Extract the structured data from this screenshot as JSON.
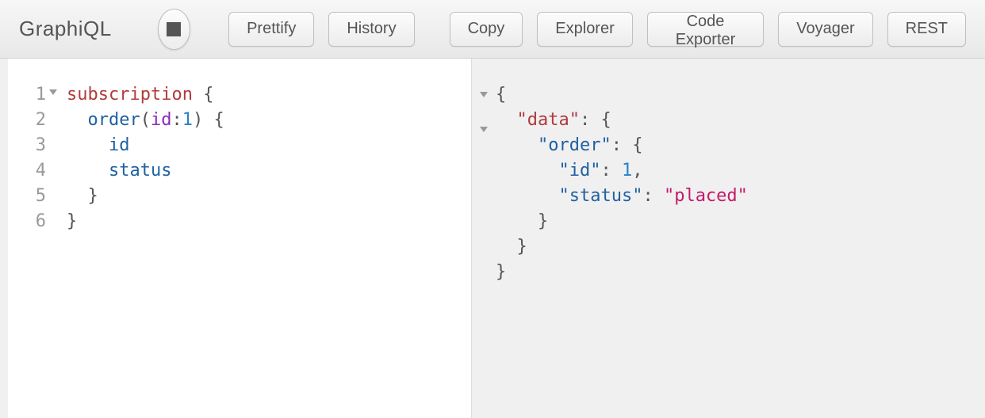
{
  "app": {
    "title": "GraphiQL"
  },
  "toolbar": {
    "prettify": "Prettify",
    "history": "History",
    "copy": "Copy",
    "explorer": "Explorer",
    "code_exporter": "Code Exporter",
    "voyager": "Voyager",
    "rest": "REST"
  },
  "query": {
    "gutter": [
      "1",
      "2",
      "3",
      "4",
      "5",
      "6"
    ],
    "lines": [
      {
        "t": [
          {
            "c": "kw",
            "v": "subscription"
          },
          {
            "c": "pun",
            "v": " {"
          }
        ]
      },
      {
        "t": [
          {
            "c": "pun",
            "v": "  "
          },
          {
            "c": "fld",
            "v": "order"
          },
          {
            "c": "pun",
            "v": "("
          },
          {
            "c": "arg",
            "v": "id"
          },
          {
            "c": "pun",
            "v": ":"
          },
          {
            "c": "num",
            "v": "1"
          },
          {
            "c": "pun",
            "v": ") {"
          }
        ]
      },
      {
        "t": [
          {
            "c": "pun",
            "v": "    "
          },
          {
            "c": "fld",
            "v": "id"
          }
        ]
      },
      {
        "t": [
          {
            "c": "pun",
            "v": "    "
          },
          {
            "c": "fld",
            "v": "status"
          }
        ]
      },
      {
        "t": [
          {
            "c": "pun",
            "v": "  }"
          }
        ]
      },
      {
        "t": [
          {
            "c": "pun",
            "v": "}"
          }
        ]
      }
    ]
  },
  "result": {
    "lines": [
      {
        "t": [
          {
            "c": "rpun",
            "v": "{"
          }
        ]
      },
      {
        "t": [
          {
            "c": "rpun",
            "v": "  "
          },
          {
            "c": "dkey",
            "v": "\"data\""
          },
          {
            "c": "rpun",
            "v": ": {"
          }
        ]
      },
      {
        "t": [
          {
            "c": "rpun",
            "v": "    "
          },
          {
            "c": "key",
            "v": "\"order\""
          },
          {
            "c": "rpun",
            "v": ": {"
          }
        ]
      },
      {
        "t": [
          {
            "c": "rpun",
            "v": "      "
          },
          {
            "c": "key",
            "v": "\"id\""
          },
          {
            "c": "rpun",
            "v": ": "
          },
          {
            "c": "rnum",
            "v": "1"
          },
          {
            "c": "rpun",
            "v": ","
          }
        ]
      },
      {
        "t": [
          {
            "c": "rpun",
            "v": "      "
          },
          {
            "c": "key",
            "v": "\"status\""
          },
          {
            "c": "rpun",
            "v": ": "
          },
          {
            "c": "rstr",
            "v": "\"placed\""
          }
        ]
      },
      {
        "t": [
          {
            "c": "rpun",
            "v": "    }"
          }
        ]
      },
      {
        "t": [
          {
            "c": "rpun",
            "v": "  }"
          }
        ]
      },
      {
        "t": [
          {
            "c": "rpun",
            "v": "}"
          }
        ]
      }
    ]
  }
}
